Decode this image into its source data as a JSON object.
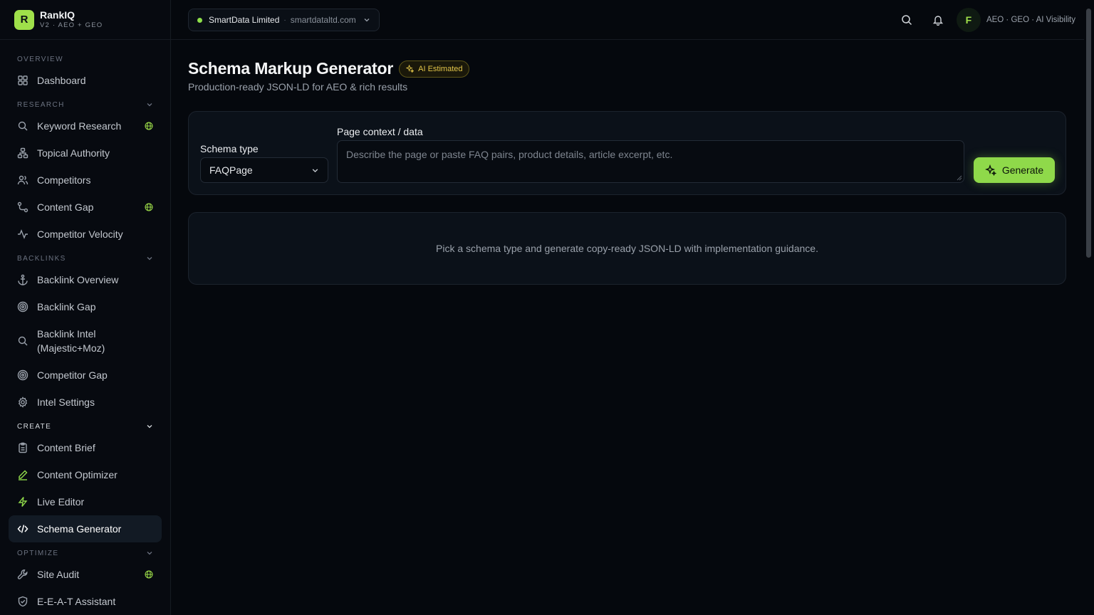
{
  "brand": {
    "logo_letter": "R",
    "name": "RankIQ",
    "subtitle": "V2 · AEO + GEO"
  },
  "topbar": {
    "project_name": "SmartData Limited",
    "project_separator": "·",
    "project_domain": "smartdataltd.com",
    "avatar_letter": "F",
    "tags": "AEO · GEO · AI Visibility"
  },
  "sidebar": {
    "overview_label": "OVERVIEW",
    "research_label": "RESEARCH",
    "backlinks_label": "BACKLINKS",
    "create_label": "CREATE",
    "optimize_label": "OPTIMIZE",
    "items": {
      "dashboard": "Dashboard",
      "keyword_research": "Keyword Research",
      "topical_authority": "Topical Authority",
      "competitors": "Competitors",
      "content_gap": "Content Gap",
      "competitor_velocity": "Competitor Velocity",
      "backlink_overview": "Backlink Overview",
      "backlink_gap": "Backlink Gap",
      "backlink_intel_1": "Backlink Intel",
      "backlink_intel_2": "(Majestic+Moz)",
      "competitor_gap": "Competitor Gap",
      "intel_settings": "Intel Settings",
      "content_brief": "Content Brief",
      "content_optimizer": "Content Optimizer",
      "live_editor": "Live Editor",
      "schema_generator": "Schema Generator",
      "site_audit": "Site Audit",
      "eeat_assistant": "E-E-A-T Assistant"
    },
    "active_item": "schema_generator"
  },
  "main": {
    "title": "Schema Markup Generator",
    "badge": "AI Estimated",
    "subtitle": "Production-ready JSON-LD for AEO & rich results",
    "schema_type_label": "Schema type",
    "schema_type_value": "FAQPage",
    "context_label": "Page context / data",
    "context_placeholder": "Describe the page or paste FAQ pairs, product details, article excerpt, etc.",
    "generate_label": "Generate",
    "empty_state": "Pick a schema type and generate copy-ready JSON-LD with implementation guidance."
  },
  "colors": {
    "accent": "#8fd94a",
    "background": "#05080d",
    "card": "#0b1119",
    "badge_text": "#e3c64a"
  }
}
